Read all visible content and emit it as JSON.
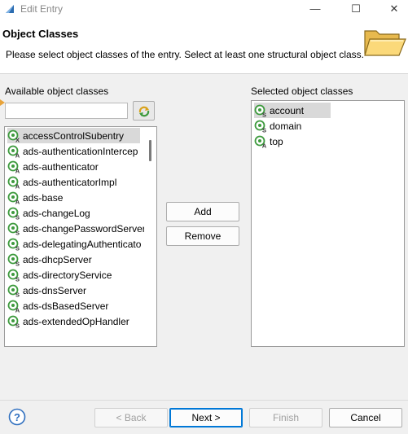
{
  "window": {
    "title": "Edit Entry",
    "minimize_glyph": "—",
    "maximize_glyph": "☐",
    "close_glyph": "✕"
  },
  "banner": {
    "title": "Object Classes",
    "description": "Please select object classes of the entry. Select at least one structural object class.",
    "icon": "folder-open-icon"
  },
  "available": {
    "label": "Available object classes",
    "filter_value": "",
    "items": [
      {
        "label": "accessControlSubentry",
        "kind": "X",
        "highlighted": true
      },
      {
        "label": "ads-authenticationIntercep",
        "kind": "A",
        "highlighted": false
      },
      {
        "label": "ads-authenticator",
        "kind": "A",
        "highlighted": false
      },
      {
        "label": "ads-authenticatorImpl",
        "kind": "A",
        "highlighted": false
      },
      {
        "label": "ads-base",
        "kind": "A",
        "highlighted": false
      },
      {
        "label": "ads-changeLog",
        "kind": "S",
        "highlighted": false
      },
      {
        "label": "ads-changePasswordServer",
        "kind": "S",
        "highlighted": false
      },
      {
        "label": "ads-delegatingAuthenticato",
        "kind": "S",
        "highlighted": false
      },
      {
        "label": "ads-dhcpServer",
        "kind": "S",
        "highlighted": false
      },
      {
        "label": "ads-directoryService",
        "kind": "S",
        "highlighted": false
      },
      {
        "label": "ads-dnsServer",
        "kind": "S",
        "highlighted": false
      },
      {
        "label": "ads-dsBasedServer",
        "kind": "A",
        "highlighted": false
      },
      {
        "label": "ads-extendedOpHandler",
        "kind": "S",
        "highlighted": false
      }
    ]
  },
  "selected": {
    "label": "Selected object classes",
    "items": [
      {
        "label": "account",
        "kind": "S",
        "highlighted": true
      },
      {
        "label": "domain",
        "kind": "S",
        "highlighted": false
      },
      {
        "label": "top",
        "kind": "A",
        "highlighted": false
      }
    ]
  },
  "buttons": {
    "add": "Add",
    "remove": "Remove",
    "back": "< Back",
    "next": "Next >",
    "finish": "Finish",
    "cancel": "Cancel"
  },
  "colors": {
    "icon_green": "#3d9a3d",
    "default_button_border": "#0078d7",
    "help_blue": "#2f6fbf"
  }
}
